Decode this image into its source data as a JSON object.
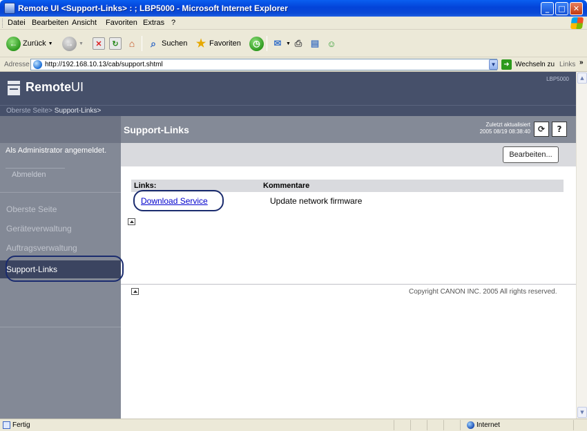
{
  "window": {
    "title": "Remote UI <Support-Links> : ; LBP5000 - Microsoft Internet Explorer"
  },
  "menu": [
    "Datei",
    "Bearbeiten",
    "Ansicht",
    "Favoriten",
    "Extras",
    "?"
  ],
  "toolbar": {
    "back_label": "Zurück",
    "search_label": "Suchen",
    "favorites_label": "Favoriten"
  },
  "addressbar": {
    "label": "Adresse",
    "url": "http://192.168.10.13/cab/support.shtml",
    "go_label": "Wechseln zu",
    "links_label": "Links"
  },
  "header": {
    "brand_part1": "Remote",
    "brand_part2": "UI",
    "model": "LBP5000"
  },
  "breadcrumb": {
    "home": "Oberste Seite",
    "separator": "> ",
    "current": "Support-Links>"
  },
  "sidebar": {
    "admin_text": "Als Administrator angemeldet.",
    "logout_label": "Abmelden",
    "items": [
      {
        "label": "Oberste Seite"
      },
      {
        "label": "Geräteverwaltung"
      },
      {
        "label": "Auftragsverwaltung"
      },
      {
        "label": "Support-Links"
      }
    ]
  },
  "content": {
    "title": "Support-Links",
    "updated_label": "Zuletzt aktualisiert",
    "updated_time": "2005 08/19 08:38:40",
    "edit_label": "Bearbeiten...",
    "table": {
      "headers": [
        "Links:",
        "Kommentare"
      ],
      "rows": [
        {
          "link": "Download Service",
          "comment": "Update network firmware"
        }
      ]
    },
    "copyright": "Copyright CANON INC. 2005 All rights reserved."
  },
  "statusbar": {
    "status": "Fertig",
    "zone": "Internet"
  },
  "colors": {
    "header": "#46506a",
    "sidebar": "#838996",
    "active_nav": "#3b4460",
    "highlight_outline": "#1a2b6e"
  }
}
